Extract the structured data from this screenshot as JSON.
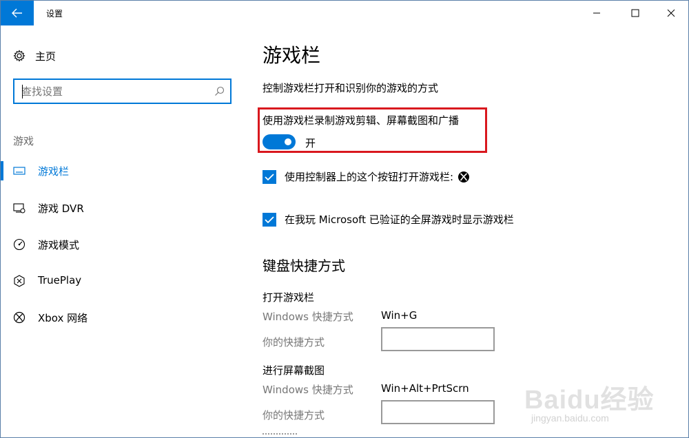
{
  "window": {
    "title": "设置",
    "accent": "#0078d7"
  },
  "sidebar": {
    "home_label": "主页",
    "search_placeholder": "查找设置",
    "section_label": "游戏",
    "items": [
      {
        "label": "游戏栏",
        "icon": "gamebar-icon",
        "active": true
      },
      {
        "label": "游戏 DVR",
        "icon": "game-dvr-icon",
        "active": false
      },
      {
        "label": "游戏模式",
        "icon": "game-mode-icon",
        "active": false
      },
      {
        "label": "TruePlay",
        "icon": "trueplay-icon",
        "active": false
      },
      {
        "label": "Xbox 网络",
        "icon": "xbox-icon",
        "active": false
      }
    ]
  },
  "main": {
    "title": "游戏栏",
    "description": "控制游戏栏打开和识别你的游戏的方式",
    "record_toggle": {
      "label": "使用游戏栏录制游戏剪辑、屏幕截图和广播",
      "state_label": "开",
      "on": true,
      "highlight_color": "#d9181e"
    },
    "checkboxes": [
      {
        "label": "使用控制器上的这个按钮打开游戏栏:",
        "checked": true,
        "trailing_icon": "xbox-icon"
      },
      {
        "label": "在我玩 Microsoft 已验证的全屏游戏时显示游戏栏",
        "checked": true
      }
    ],
    "shortcuts": {
      "title": "键盘快捷方式",
      "groups": [
        {
          "title": "打开游戏栏",
          "windows_label": "Windows 快捷方式",
          "windows_value": "Win+G",
          "yours_label": "你的快捷方式",
          "yours_value": ""
        },
        {
          "title": "进行屏幕截图",
          "windows_label": "Windows 快捷方式",
          "windows_value": "Win+Alt+PrtScrn",
          "yours_label": "你的快捷方式",
          "yours_value": ""
        }
      ]
    }
  },
  "watermark": {
    "main": "Baidu经验",
    "sub": "jingyan.baidu.com"
  }
}
